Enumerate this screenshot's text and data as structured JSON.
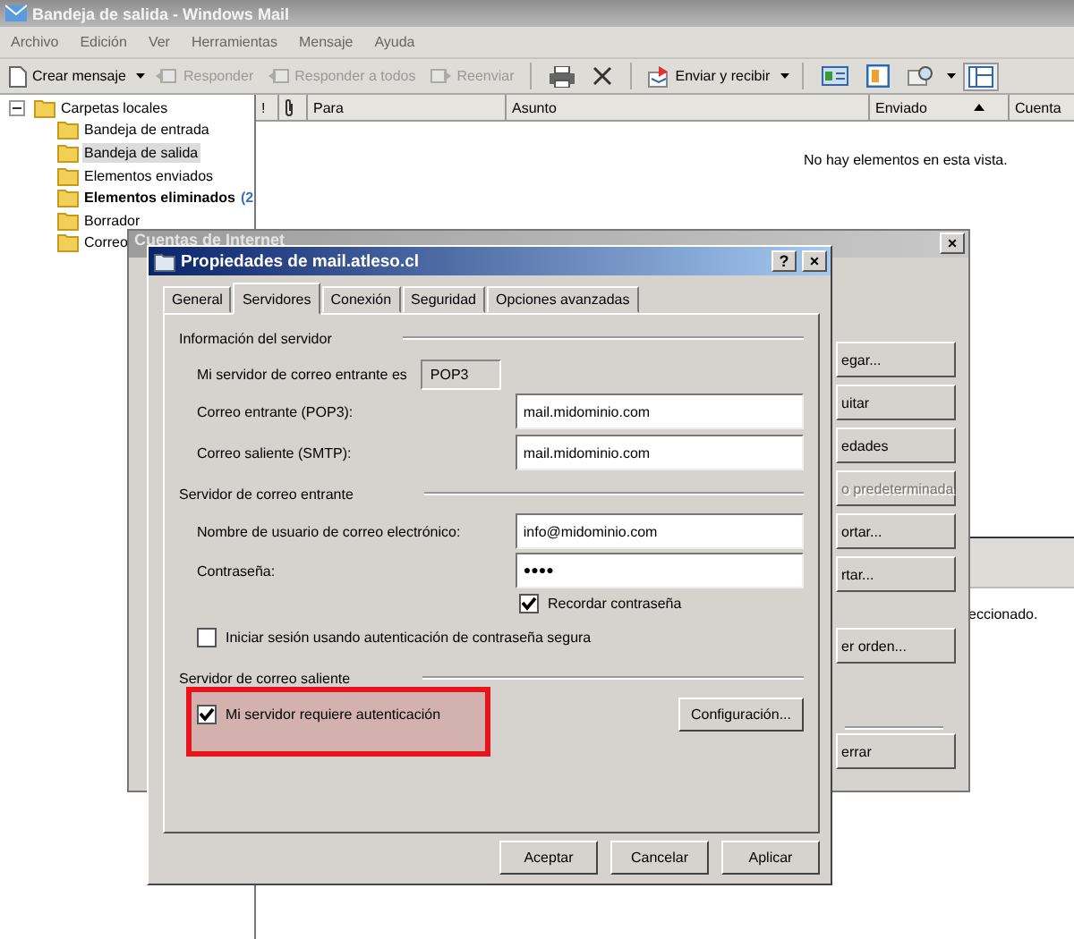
{
  "window": {
    "title": "Bandeja de salida - Windows Mail"
  },
  "menu": [
    "Archivo",
    "Edición",
    "Ver",
    "Herramientas",
    "Mensaje",
    "Ayuda"
  ],
  "toolbar": [
    {
      "label": "Crear mensaje",
      "disabled": false,
      "dropdown": true
    },
    {
      "label": "Responder",
      "disabled": true,
      "dropdown": false
    },
    {
      "label": "Responder a todos",
      "disabled": true,
      "dropdown": false
    },
    {
      "label": "Reenviar",
      "disabled": true,
      "dropdown": false
    },
    {
      "label": "Enviar y recibir",
      "disabled": false,
      "dropdown": true
    }
  ],
  "folders": {
    "label": "Carpetas locales",
    "expanded": true,
    "children": [
      {
        "label": "Bandeja de entrada",
        "selected": false,
        "unread": false
      },
      {
        "label": "Bandeja de salida",
        "selected": true,
        "unread": false
      },
      {
        "label": "Elementos enviados",
        "selected": false,
        "unread": false
      },
      {
        "label": "Elementos eliminados",
        "count": "(2",
        "selected": false,
        "unread": true
      },
      {
        "label": "Borrador",
        "selected": false,
        "unread": false
      },
      {
        "label": "Correo",
        "selected": false,
        "unread": false
      }
    ]
  },
  "columns": [
    {
      "kind": "text",
      "label": "!",
      "sorted": false
    },
    {
      "kind": "icon",
      "sorted": false
    },
    {
      "kind": "text",
      "label": "Para",
      "sorted": false
    },
    {
      "kind": "text",
      "label": "Asunto",
      "sorted": false
    },
    {
      "kind": "text",
      "label": "Enviado",
      "sorted": true
    },
    {
      "kind": "text",
      "label": "Cuenta",
      "sorted": false
    }
  ],
  "empty_message": "No hay elementos en esta vista.",
  "preview_text": "eccionado.",
  "accounts_window": {
    "title": "Cuentas de Internet",
    "close_button": "×",
    "buttons": [
      {
        "label": "egar...",
        "disabled": false
      },
      {
        "label": "uitar",
        "disabled": false
      },
      {
        "label": "edades",
        "disabled": false
      },
      {
        "label": "o predeterminada",
        "disabled": true
      },
      {
        "label": "ortar...",
        "disabled": false
      },
      {
        "label": "rtar...",
        "disabled": false
      },
      {
        "label": "er orden...",
        "disabled": false
      },
      {
        "label": "errar",
        "disabled": false
      }
    ]
  },
  "properties_dialog": {
    "title": "Propiedades de mail.atleso.cl",
    "help_button": "?",
    "close_button": "×",
    "tabs": [
      {
        "label": "General",
        "selected": false
      },
      {
        "label": "Servidores",
        "selected": true
      },
      {
        "label": "Conexión",
        "selected": false
      },
      {
        "label": "Seguridad",
        "selected": false
      },
      {
        "label": "Opciones avanzadas",
        "selected": false
      }
    ],
    "server_info": {
      "heading": "Información del servidor",
      "incoming_type_label": "Mi servidor de correo entrante es",
      "incoming_type": "POP3",
      "incoming_label": "Correo entrante (POP3):",
      "incoming_value": "mail.midominio.com",
      "outgoing_label": "Correo saliente (SMTP):",
      "outgoing_value": "mail.midominio.com"
    },
    "incoming_server": {
      "heading": "Servidor de correo entrante",
      "username_label": "Nombre de usuario de correo electrónico:",
      "username_value": "info@midominio.com",
      "password_label": "Contraseña:",
      "password_value": "●●●●",
      "remember": {
        "label": "Recordar contraseña",
        "checked": true
      },
      "secure_auth": {
        "label": "Iniciar sesión usando autenticación de contraseña segura",
        "checked": false
      }
    },
    "outgoing_server": {
      "heading": "Servidor de correo saliente",
      "auth": {
        "label": "Mi servidor requiere autenticación",
        "checked": true
      },
      "settings_button": "Configuración..."
    },
    "buttons": [
      "Aceptar",
      "Cancelar",
      "Aplicar"
    ]
  }
}
